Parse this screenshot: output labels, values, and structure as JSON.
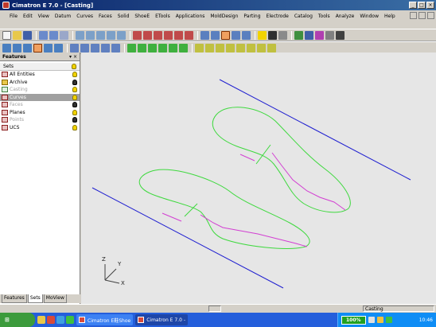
{
  "window": {
    "title": "Cimatron E 7.0 - [Casting]"
  },
  "menu": [
    "File",
    "Edit",
    "View",
    "Datum",
    "Curves",
    "Faces",
    "Solid",
    "ShoeE",
    "ETools",
    "Applications",
    "MoldDesign",
    "Parting",
    "Electrode",
    "Catalog",
    "Tools",
    "Analyze",
    "Window",
    "Help"
  ],
  "features_panel": {
    "title": "Features",
    "sets_header": "Sets",
    "sets": [
      {
        "label": "All Entities",
        "visible": true,
        "dim": false,
        "selected": false
      },
      {
        "label": "Archive",
        "visible": false,
        "dim": false,
        "selected": false
      },
      {
        "label": "Casting",
        "visible": true,
        "dim": true,
        "selected": false
      },
      {
        "label": "Curves",
        "visible": true,
        "dim": false,
        "selected": true
      },
      {
        "label": "Faces",
        "visible": false,
        "dim": true,
        "selected": false
      },
      {
        "label": "Planes",
        "visible": true,
        "dim": false,
        "selected": false
      },
      {
        "label": "Points",
        "visible": false,
        "dim": true,
        "selected": false
      },
      {
        "label": "UCS",
        "visible": true,
        "dim": false,
        "selected": false
      }
    ],
    "tabs": [
      "Features",
      "Sets",
      "MoView"
    ]
  },
  "axes": {
    "x": "X",
    "y": "Y",
    "z": "Z"
  },
  "status": {
    "doc_name": "Casting"
  },
  "taskbar": {
    "tasks": [
      {
        "label": "Cimatron E鞋Shoe",
        "active": false
      },
      {
        "label": "Cimatron E 7.0 -",
        "active": true
      }
    ],
    "zoom": "100%",
    "clock": "10:46"
  },
  "colors": {
    "boundary_lines": "#1f1fd0",
    "outline_curves": "#3ed93e",
    "parting_curves": "#d23fd2",
    "viewport_bg": "#e6e6e6"
  }
}
